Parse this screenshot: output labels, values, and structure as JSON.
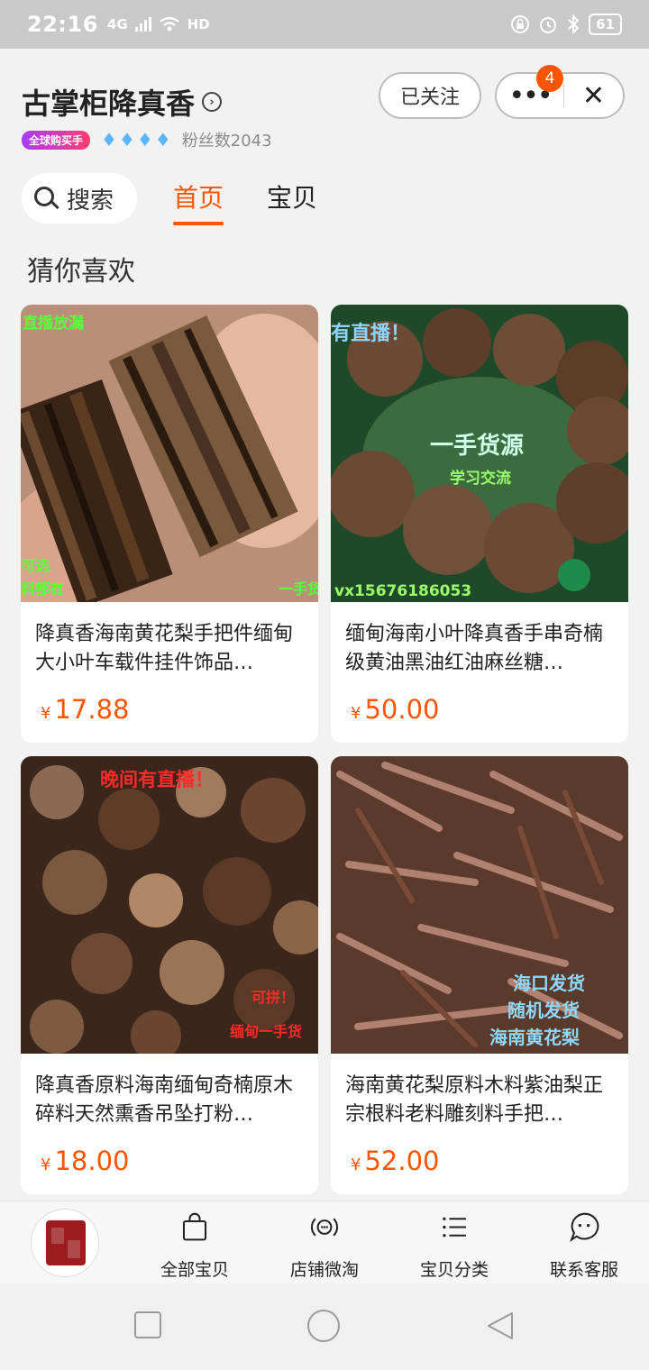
{
  "status_bar": {
    "time": "22:16",
    "network": "4G",
    "wifi_label": "HD",
    "battery": "61"
  },
  "header": {
    "shop_name": "古掌柜降真香",
    "global_badge": "全球购买手",
    "fans": "粉丝数2043",
    "follow_label": "已关注",
    "notification_count": "4",
    "close_symbol": "✕",
    "more_symbol": "•••"
  },
  "nav_tabs": {
    "search_label": "搜索",
    "tabs": [
      "首页",
      "宝贝"
    ]
  },
  "section": {
    "title": "猜你喜欢"
  },
  "currency": "¥",
  "products": [
    {
      "title": "降真香海南黄花梨手把件缅甸大小叶车载件挂件饰品…",
      "price": "17.88",
      "overlay_texts": [
        "直播放漏",
        "可选",
        "料都有",
        "一手货"
      ]
    },
    {
      "title": "缅甸海南小叶降真香手串奇楠级黄油黑油红油麻丝糖…",
      "price": "50.00",
      "overlay_texts": [
        "有直播！",
        "一手货源",
        "学习交流",
        "vx15676186053"
      ]
    },
    {
      "title": "降真香原料海南缅甸奇楠原木碎料天然熏香吊坠打粉…",
      "price": "18.00",
      "overlay_texts": [
        "晚间有直播！",
        "可拼！",
        "缅甸一手货"
      ]
    },
    {
      "title": "海南黄花梨原料木料紫油梨正宗根料老料雕刻料手把…",
      "price": "52.00",
      "overlay_texts": [
        "海口发货",
        "随机发货",
        "海南黄花梨"
      ]
    }
  ],
  "bottom_nav": {
    "items": [
      "全部宝贝",
      "店铺微淘",
      "宝贝分类",
      "联系客服"
    ]
  },
  "colors": {
    "accent": "#ff5500",
    "status_bar": "#c9c9c9",
    "background": "#f2f2f2"
  },
  "icons": [
    "search-icon",
    "shopping-bag-icon",
    "broadcast-icon",
    "list-icon",
    "chat-bubble-icon"
  ]
}
